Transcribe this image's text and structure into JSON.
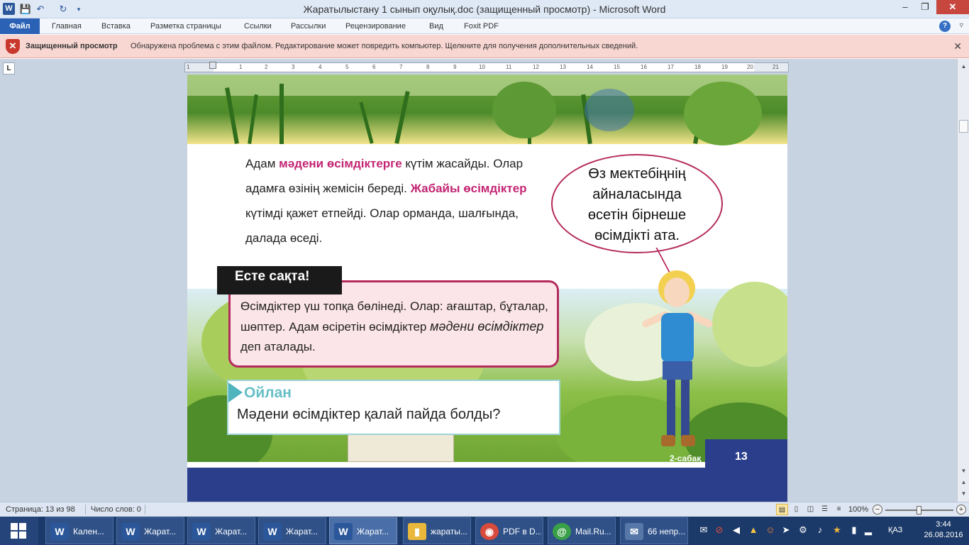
{
  "titlebar": {
    "app_icon": "W",
    "title": "Жаратылыстану 1 сынып оқулық.doc (защищенный просмотр)  -  Microsoft Word",
    "minimize": "–",
    "maximize": "❐",
    "close": "✕"
  },
  "ribbon": {
    "tabs": [
      "Файл",
      "Главная",
      "Вставка",
      "Разметка страницы",
      "Ссылки",
      "Рассылки",
      "Рецензирование",
      "Вид",
      "Foxit PDF"
    ],
    "help": "?",
    "collapse": "▿"
  },
  "protected_view": {
    "label": "Защищенный просмотр",
    "message": "Обнаружена проблема с этим файлом. Редактирование может повредить компьютер. Щелкните для получения дополнительных сведений.",
    "close": "✕"
  },
  "ruler": {
    "corner": "L",
    "numbers": [
      "1",
      "1",
      "2",
      "3",
      "4",
      "5",
      "6",
      "7",
      "8",
      "9",
      "10",
      "11",
      "12",
      "13",
      "14",
      "15",
      "16",
      "17",
      "18",
      "19",
      "20",
      "21"
    ]
  },
  "document": {
    "para": {
      "p1": "Адам ",
      "h1": "мәдени өсімдіктерге",
      "p2": " күтім жасайды. Олар адамға өзінің жемісін береді. ",
      "h2": "Жабайы өсімдіктер",
      "p3": " күтімді қажет етпейді. Олар орманда, шалғында, далада өседі."
    },
    "bubble": [
      "Өз мектебіңнің",
      "айналасында",
      "өсетін бірнеше",
      "өсімдікті ата."
    ],
    "remember": {
      "tag": "Есте сақта!",
      "text1": " Өсімдіктер үш топқа бөлінеді. Олар: ағаштар, бұталар, шөптер. Адам өсіретін өсімдіктер ",
      "em": "мәдени өсімдіктер",
      "text2": " деп аталады."
    },
    "think": {
      "title": "Ойлан",
      "question": "Мәдени өсімдіктер қалай пайда болды?"
    },
    "lesson_label": "2-сабақ",
    "page_number": "13"
  },
  "statusbar": {
    "page": "Страница: 13 из 98",
    "words": "Число слов: 0",
    "zoom": "100%",
    "zoom_out": "−",
    "zoom_in": "+"
  },
  "taskbar": {
    "buttons": [
      {
        "label": "Кален...",
        "icon": "W",
        "color": "#2b579a"
      },
      {
        "label": "Жарат...",
        "icon": "W",
        "color": "#2b579a"
      },
      {
        "label": "Жарат...",
        "icon": "W",
        "color": "#2b579a"
      },
      {
        "label": "Жарат...",
        "icon": "W",
        "color": "#2b579a"
      },
      {
        "label": "Жарат...",
        "icon": "W",
        "color": "#2b579a"
      },
      {
        "label": "жараты...",
        "icon": "▮",
        "color": "#e8b73c"
      },
      {
        "label": "PDF в D...",
        "icon": "◉",
        "color": "#d64b3b"
      },
      {
        "label": "Mail.Ru...",
        "icon": "@",
        "color": "#3aa047"
      },
      {
        "label": "66 непр...",
        "icon": "✉",
        "color": "#5677a8"
      }
    ],
    "language": "ҚАЗ",
    "time": "3:44",
    "date": "26.08.2016"
  },
  "colors": {
    "highlight": "#c32573",
    "frame": "#b52a5d",
    "think_title": "#66bfc6",
    "footer": "#2b3e8c"
  }
}
